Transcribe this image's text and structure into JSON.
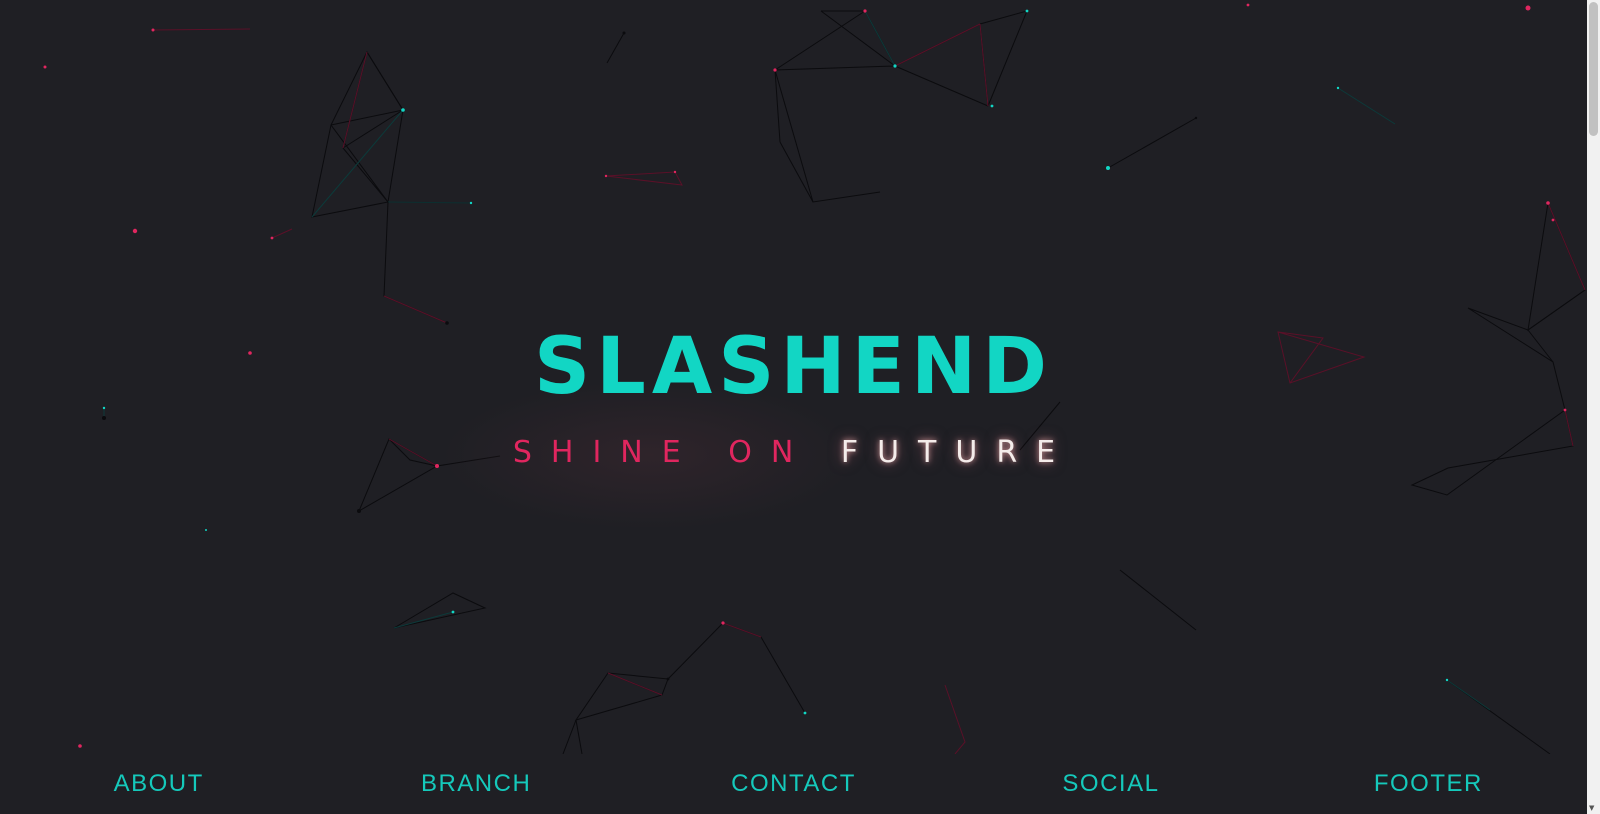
{
  "hero": {
    "title": "SLASHEND",
    "tagline_part1": "SHINE ON ",
    "tagline_part2": "FUTURE"
  },
  "nav": {
    "items": [
      "ABOUT",
      "BRANCH",
      "CONTACT",
      "SOCIAL",
      "FOOTER"
    ]
  },
  "colors": {
    "background": "#1f1f24",
    "accent_teal": "#12d6c4",
    "accent_pink": "#e0265f",
    "glow_white": "#f4ecea"
  },
  "icons": {
    "scroll_arrow": "scroll-down-arrow-icon"
  }
}
